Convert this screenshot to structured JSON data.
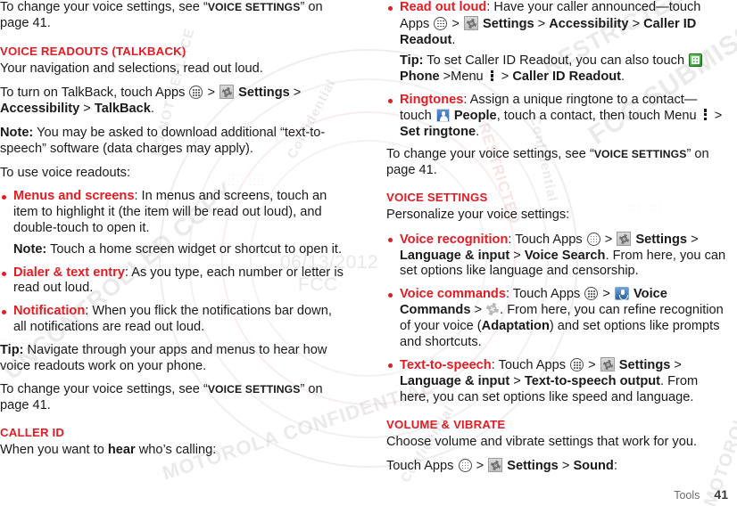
{
  "document": {
    "footer": {
      "section": "Tools",
      "page": "41"
    }
  },
  "watermark": {
    "date": "06/13/2012",
    "agency": "FCC",
    "phrases": [
      "MOTOROLA CONFIDENTIAL",
      "RESTRICTED",
      "FCC SUBMISSION",
      "UNCONTROLLED COPY",
      "Confidential",
      "DO NOT REPLACE"
    ]
  },
  "left_column": {
    "intro": {
      "pre": "To change your voice settings, see “",
      "xref": "Voice settings",
      "post": "” on page 41."
    },
    "section_voice_readouts": {
      "heading": "Voice Readouts (TalkBack)",
      "lede": "Your navigation and selections, read out loud.",
      "turn_on_pre": "To turn on TalkBack, touch Apps ",
      "turn_on_sep1": " > ",
      "turn_on_settings": "Settings",
      "turn_on_chain": " > ",
      "turn_on_accessibility": "Accessibility",
      "turn_on_sep2": " > ",
      "turn_on_talkback": "TalkBack",
      "turn_on_end": ".",
      "note_label": "Note:",
      "note_text": " You may be asked to download additional “text-to-speech” software (data charges may apply).",
      "use_intro": "To use voice readouts:",
      "bullets": [
        {
          "lead": "Menus and screens",
          "body": ": In menus and screens, touch an item to highlight it (the item will be read out loud), and double-touch to open it.",
          "sub_label": "Note:",
          "sub_text": " Touch a home screen widget or shortcut to open it."
        },
        {
          "lead": "Dialer & text entry",
          "body": ": As you type, each number or letter is read out loud.",
          "sub_label": "",
          "sub_text": ""
        },
        {
          "lead": "Notification",
          "body": ": When you flick the notifications bar down, all notifications are read out loud.",
          "sub_label": "",
          "sub_text": ""
        }
      ],
      "tip_label": "Tip:",
      "tip_text": " Navigate through your apps and menus to hear how voice readouts work on your phone.",
      "outro_pre": "To change your voice settings, see “",
      "outro_xref": "Voice settings",
      "outro_post": "” on page 41."
    },
    "section_caller_id": {
      "heading": "Caller ID",
      "lede_pre": "When you want to ",
      "lede_bold": "hear",
      "lede_post": " who’s calling:"
    }
  },
  "right_column": {
    "caller_id_bullets": [
      {
        "lead": "Read out loud",
        "body_1": ": Have your caller announced—touch Apps ",
        "sep_1": " > ",
        "bold_settings": "Settings",
        "sep_2": " > ",
        "bold_accessibility": "Accessibility",
        "sep_3": " > ",
        "bold_caller_id_readout": "Caller ID Readout",
        "body_end": ".",
        "tip_label": "Tip:",
        "tip_text": " To set Caller ID Readout, you can also touch ",
        "tip_phone": "Phone",
        "tip_menu": " >Menu ",
        "tip_sep": " > ",
        "tip_target": "Caller ID Readout",
        "tip_end": "."
      },
      {
        "lead": "Ringtones",
        "body_1": ": Assign a unique ringtone to a contact—touch ",
        "bold_people": "People",
        "body_2": ", touch a contact, then touch Menu ",
        "sep": " > ",
        "bold_set_ringtone": "Set ringtone",
        "body_end": "."
      }
    ],
    "outro": {
      "pre": "To change your voice settings, see “",
      "xref": "Voice settings",
      "post": "” on page 41."
    },
    "section_voice_settings": {
      "heading": "Voice settings",
      "lede": "Personalize your voice settings:",
      "bullets": [
        {
          "lead": "Voice recognition",
          "body_1": ": Touch Apps ",
          "sep_1": " > ",
          "b1": "Settings",
          "sep_2": " > ",
          "b2": "Language & input",
          "sep_3": " > ",
          "b3": "Voice Search",
          "body_end": ". From here, you can set options like language and censorship."
        },
        {
          "lead": "Voice commands",
          "body_1": ": Touch Apps ",
          "sep_1": " > ",
          "b1": "Voice Commands",
          "sep_2": " > ",
          "body_mid": ". From here, you can refine recognition of your voice (",
          "b_adaptation": "Adaptation",
          "body_end": ") and set options like prompts and shortcuts."
        },
        {
          "lead": "Text-to-speech",
          "body_1": ": Touch Apps ",
          "sep_1": " > ",
          "b1": "Settings",
          "sep_2": " > ",
          "b2": "Language & input",
          "sep_3": " > ",
          "b3": "Text-to-speech output",
          "body_end": ". From here, you can set options like speed and language."
        }
      ]
    },
    "section_volume_vibrate": {
      "heading": "Volume & vibrate",
      "lede": "Choose volume and vibrate settings that work for you.",
      "touch_pre": "Touch Apps ",
      "sep_1": " > ",
      "b1": "Settings",
      "sep_2": " > ",
      "b2": "Sound",
      "end": ":"
    }
  },
  "colors": {
    "accent_red": "#e31b23",
    "text": "#1a1a1a",
    "footer_text": "#6d6d6d"
  }
}
